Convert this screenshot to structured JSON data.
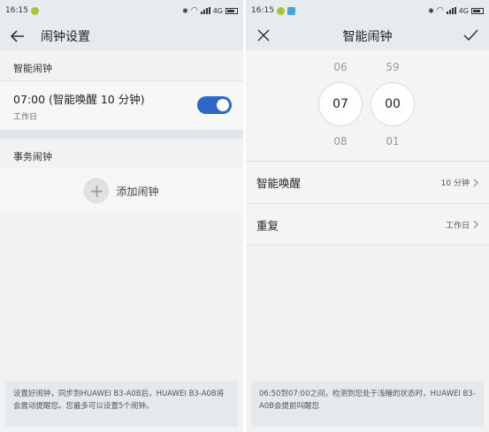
{
  "left": {
    "status": {
      "time": "16:15",
      "network": "4G"
    },
    "appbar": {
      "title": "闹钟设置"
    },
    "smart_section": {
      "title": "智能闹钟"
    },
    "alarm": {
      "time_label": "07:00 (智能唤醒 10 分钟)",
      "repeat": "工作日",
      "enabled": true
    },
    "task_section": {
      "title": "事务闹钟"
    },
    "add": {
      "label": "添加闹钟"
    },
    "footer": {
      "text": "设置好闹钟，同步到HUAWEI B3-A0B后，HUAWEI B3-A0B将会震动提醒您。您最多可以设置5个闹钟。"
    }
  },
  "right": {
    "status": {
      "time": "16:15",
      "network": "4G"
    },
    "appbar": {
      "title": "智能闹钟"
    },
    "picker": {
      "hours": {
        "prev": "06",
        "current": "07",
        "next": "08"
      },
      "minutes": {
        "prev": "59",
        "current": "00",
        "next": "01"
      }
    },
    "smart_wake": {
      "label": "智能唤醒",
      "value": "10 分钟"
    },
    "repeat": {
      "label": "重复",
      "value": "工作日"
    },
    "footer": {
      "text": "06:50到07:00之间，检测到您处于浅睡的状态时，HUAWEI B3-A0B会提前叫醒您"
    }
  },
  "colors": {
    "accent": "#2e66c9",
    "header_bg": "#e6ebee",
    "footer_bg": "#e3e9ec"
  },
  "icons": {
    "back": "arrow-left-icon",
    "close": "close-icon",
    "confirm": "check-icon",
    "add": "plus-icon",
    "chevron": "chevron-right-icon"
  }
}
